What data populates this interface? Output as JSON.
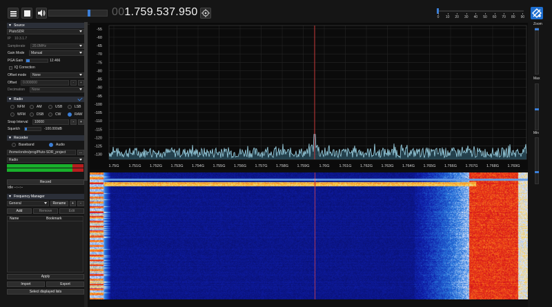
{
  "toolbar": {
    "frequency_lead": "00",
    "frequency_main": "1.759.537.950",
    "volume_level": 0.68,
    "snr_scale_ticks": [
      "0",
      "10",
      "20",
      "30",
      "40",
      "50",
      "60",
      "70",
      "80",
      "90"
    ],
    "snr_level": 0.0
  },
  "source": {
    "header": "Source",
    "device": "PlutoSDR",
    "ip_label": "IP",
    "ip_value": "10.3.1.7",
    "samplerate_label": "Samplerate",
    "samplerate_value": "20.0MHz",
    "gain_mode_label": "Gain Mode",
    "gain_mode_value": "Manual",
    "pga_gain_label": "PGA Gain",
    "pga_gain_value": "12.466",
    "pga_gain_level": 0.17,
    "iq_correction_label": "IQ Correction",
    "offset_mode_label": "Offset mode",
    "offset_mode_value": "None",
    "offset_label": "Offset",
    "offset_value": "0.000000",
    "offset_minus": "-",
    "offset_plus": "+",
    "decimation_label": "Decimation",
    "decimation_value": "None"
  },
  "radio": {
    "header": "Radio",
    "modes_row1": [
      "NFM",
      "AM",
      "USB",
      "LSB"
    ],
    "modes_row2": [
      "WFM",
      "DSB",
      "CW",
      "RAW"
    ],
    "selected_mode": "RAW",
    "snap_interval_label": "Snap Interval",
    "snap_interval_value": "10000",
    "snap_minus": "-",
    "snap_plus": "+",
    "squelch_label": "Squelch",
    "squelch_value": "-100.000dB",
    "squelch_level": 0.0
  },
  "recorder": {
    "header": "Recorder",
    "baseband_label": "Baseband",
    "audio_label": "Audio",
    "path_value": "/home/ondro/prog/Pluto-SDR_project",
    "path_button": "...",
    "stream_value": "Radio",
    "meter_levels": [
      0.86,
      0.86
    ],
    "record_button": "Record",
    "status_text": "Idle --:--:--"
  },
  "frequency_manager": {
    "header": "Frequency Manager",
    "list_value": "General",
    "rename_button": "Rename",
    "plus": "+",
    "minus": "-",
    "add_button": "Add",
    "remove_button": "Remove",
    "edit_button": "Edit",
    "columns": [
      "Name",
      "Bookmark"
    ],
    "apply_button": "Apply",
    "import_button": "Import",
    "export_button": "Export",
    "select_lists_button": "Select displayed lists"
  },
  "spectrum": {
    "y_ticks": [
      "-55",
      "-60",
      "-65",
      "-70",
      "-75",
      "-80",
      "-85",
      "-90",
      "-95",
      "-100",
      "-105",
      "-110",
      "-115",
      "-120",
      "-125",
      "-130"
    ],
    "x_ticks": [
      "1.75G",
      "1.751G",
      "1.752G",
      "1.753G",
      "1.754G",
      "1.755G",
      "1.756G",
      "1.757G",
      "1.758G",
      "1.759G",
      "1.76G",
      "1.761G",
      "1.762G",
      "1.763G",
      "1.764G",
      "1.765G",
      "1.766G",
      "1.767G",
      "1.768G",
      "1.769G"
    ],
    "trace_color": "#9fd6e8",
    "marker_color": "#c83a3a"
  },
  "right_panel": {
    "zoom_label": "Zoom",
    "max_label": "Max",
    "min_label": "Min",
    "zoom_level": 0.0,
    "max_level": 0.55,
    "min_level": 0.75
  },
  "colors": {
    "accent": "#3b7fd8",
    "meter_green": "#18b02b",
    "meter_red": "#b81e1e"
  }
}
